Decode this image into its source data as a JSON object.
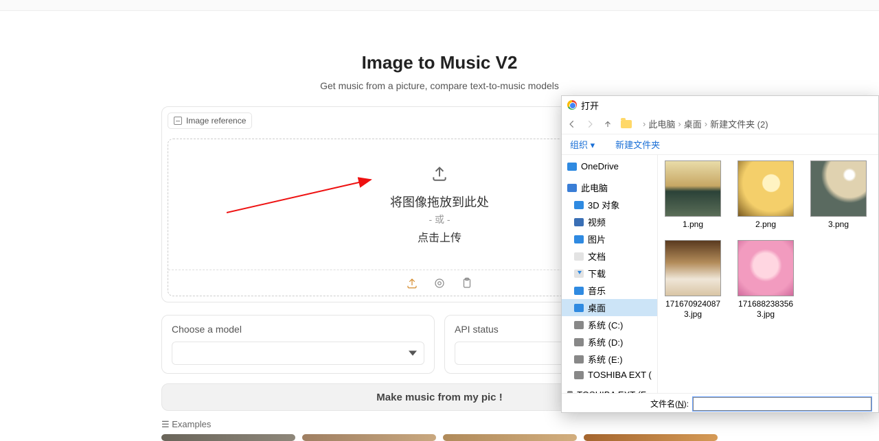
{
  "page": {
    "title": "Image to Music V2",
    "subtitle": "Get music from a picture, compare text-to-music models",
    "image_reference_tag": "Image reference",
    "drop_line1": "将图像拖放到此处",
    "drop_or": "- 或 -",
    "drop_line3": "点击上传",
    "choose_model_label": "Choose a model",
    "api_status_label": "API status",
    "make_button": "Make music from my pic !",
    "examples_label": "☰  Examples"
  },
  "dialog": {
    "title": "打开",
    "breadcrumbs": [
      "此电脑",
      "桌面",
      "新建文件夹 (2)"
    ],
    "organize": "组织 ▾",
    "new_folder": "新建文件夹",
    "filename_label_pre": "文件名(",
    "filename_label_u": "N",
    "filename_label_post": "):",
    "filename_value": "",
    "tree": [
      {
        "icon": "ic-cloud",
        "label": "OneDrive"
      },
      {
        "icon": "ic-pc",
        "label": "此电脑"
      },
      {
        "icon": "ic-3d",
        "label": "3D 对象"
      },
      {
        "icon": "ic-vid",
        "label": "视频"
      },
      {
        "icon": "ic-pic",
        "label": "图片"
      },
      {
        "icon": "ic-doc",
        "label": "文档"
      },
      {
        "icon": "ic-dl",
        "label": "下载"
      },
      {
        "icon": "ic-music",
        "label": "音乐"
      },
      {
        "icon": "ic-desk",
        "label": "桌面",
        "selected": true
      },
      {
        "icon": "ic-hdd",
        "label": "系统 (C:)"
      },
      {
        "icon": "ic-hdd",
        "label": "系统 (D:)"
      },
      {
        "icon": "ic-hdd",
        "label": "系统 (E:)"
      },
      {
        "icon": "ic-hdd",
        "label": "TOSHIBA EXT ("
      },
      {
        "icon": "ic-hdd",
        "label": "TOSHIBA EXT (F ▸"
      }
    ],
    "files_row1": [
      {
        "cls": "p1",
        "label": "1.png"
      },
      {
        "cls": "p2",
        "label": "2.png"
      },
      {
        "cls": "p3",
        "label": "3.png"
      }
    ],
    "files_row2": [
      {
        "cls": "p4",
        "label": "1716709240873.jpg"
      },
      {
        "cls": "p5",
        "label": "1716882383563.jpg"
      }
    ]
  }
}
